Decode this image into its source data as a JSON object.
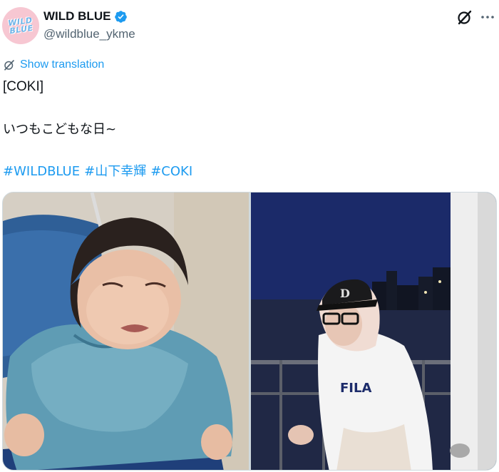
{
  "account": {
    "display_name": "WILD BLUE",
    "handle": "@wildblue_ykme",
    "avatar_text": "WILD\nBLUE",
    "verified_color": "#1d9bf0"
  },
  "actions": {
    "show_translation": "Show translation",
    "more_symbol": "···"
  },
  "tweet": {
    "line1": "[COKI]",
    "line2": "いつもこどもな日~",
    "hashtags": [
      "#WILDBLUE",
      "#山下幸輝",
      "#COKI"
    ]
  },
  "media": {
    "count": 2,
    "photos": [
      {
        "icon": "baby-photo"
      },
      {
        "icon": "night-portrait-photo"
      }
    ]
  },
  "colors": {
    "link": "#1d9bf0",
    "text": "#0f1419",
    "secondary": "#536471"
  }
}
